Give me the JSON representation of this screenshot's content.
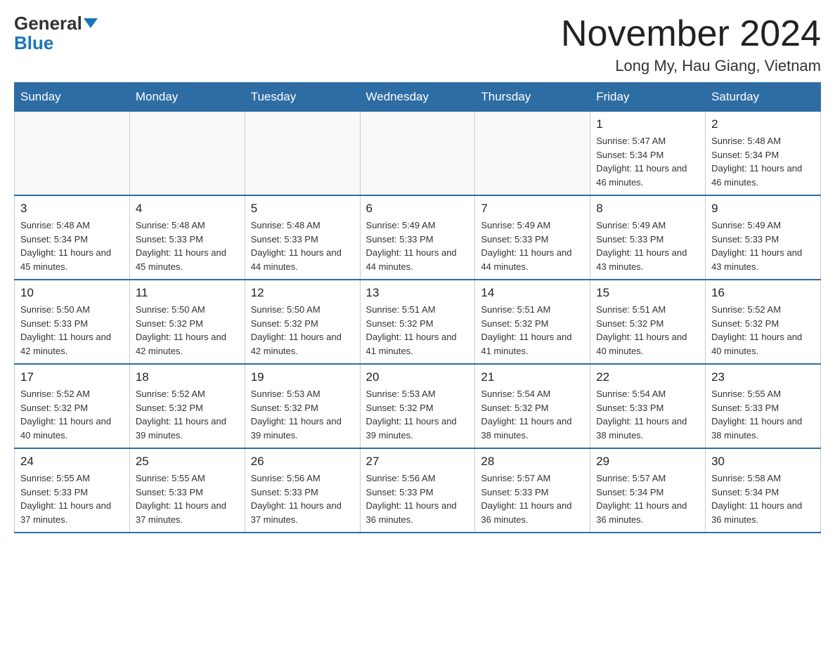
{
  "logo": {
    "general": "General",
    "blue": "Blue"
  },
  "title": "November 2024",
  "subtitle": "Long My, Hau Giang, Vietnam",
  "weekdays": [
    "Sunday",
    "Monday",
    "Tuesday",
    "Wednesday",
    "Thursday",
    "Friday",
    "Saturday"
  ],
  "weeks": [
    [
      {
        "day": "",
        "info": ""
      },
      {
        "day": "",
        "info": ""
      },
      {
        "day": "",
        "info": ""
      },
      {
        "day": "",
        "info": ""
      },
      {
        "day": "",
        "info": ""
      },
      {
        "day": "1",
        "info": "Sunrise: 5:47 AM\nSunset: 5:34 PM\nDaylight: 11 hours and 46 minutes."
      },
      {
        "day": "2",
        "info": "Sunrise: 5:48 AM\nSunset: 5:34 PM\nDaylight: 11 hours and 46 minutes."
      }
    ],
    [
      {
        "day": "3",
        "info": "Sunrise: 5:48 AM\nSunset: 5:34 PM\nDaylight: 11 hours and 45 minutes."
      },
      {
        "day": "4",
        "info": "Sunrise: 5:48 AM\nSunset: 5:33 PM\nDaylight: 11 hours and 45 minutes."
      },
      {
        "day": "5",
        "info": "Sunrise: 5:48 AM\nSunset: 5:33 PM\nDaylight: 11 hours and 44 minutes."
      },
      {
        "day": "6",
        "info": "Sunrise: 5:49 AM\nSunset: 5:33 PM\nDaylight: 11 hours and 44 minutes."
      },
      {
        "day": "7",
        "info": "Sunrise: 5:49 AM\nSunset: 5:33 PM\nDaylight: 11 hours and 44 minutes."
      },
      {
        "day": "8",
        "info": "Sunrise: 5:49 AM\nSunset: 5:33 PM\nDaylight: 11 hours and 43 minutes."
      },
      {
        "day": "9",
        "info": "Sunrise: 5:49 AM\nSunset: 5:33 PM\nDaylight: 11 hours and 43 minutes."
      }
    ],
    [
      {
        "day": "10",
        "info": "Sunrise: 5:50 AM\nSunset: 5:33 PM\nDaylight: 11 hours and 42 minutes."
      },
      {
        "day": "11",
        "info": "Sunrise: 5:50 AM\nSunset: 5:32 PM\nDaylight: 11 hours and 42 minutes."
      },
      {
        "day": "12",
        "info": "Sunrise: 5:50 AM\nSunset: 5:32 PM\nDaylight: 11 hours and 42 minutes."
      },
      {
        "day": "13",
        "info": "Sunrise: 5:51 AM\nSunset: 5:32 PM\nDaylight: 11 hours and 41 minutes."
      },
      {
        "day": "14",
        "info": "Sunrise: 5:51 AM\nSunset: 5:32 PM\nDaylight: 11 hours and 41 minutes."
      },
      {
        "day": "15",
        "info": "Sunrise: 5:51 AM\nSunset: 5:32 PM\nDaylight: 11 hours and 40 minutes."
      },
      {
        "day": "16",
        "info": "Sunrise: 5:52 AM\nSunset: 5:32 PM\nDaylight: 11 hours and 40 minutes."
      }
    ],
    [
      {
        "day": "17",
        "info": "Sunrise: 5:52 AM\nSunset: 5:32 PM\nDaylight: 11 hours and 40 minutes."
      },
      {
        "day": "18",
        "info": "Sunrise: 5:52 AM\nSunset: 5:32 PM\nDaylight: 11 hours and 39 minutes."
      },
      {
        "day": "19",
        "info": "Sunrise: 5:53 AM\nSunset: 5:32 PM\nDaylight: 11 hours and 39 minutes."
      },
      {
        "day": "20",
        "info": "Sunrise: 5:53 AM\nSunset: 5:32 PM\nDaylight: 11 hours and 39 minutes."
      },
      {
        "day": "21",
        "info": "Sunrise: 5:54 AM\nSunset: 5:32 PM\nDaylight: 11 hours and 38 minutes."
      },
      {
        "day": "22",
        "info": "Sunrise: 5:54 AM\nSunset: 5:33 PM\nDaylight: 11 hours and 38 minutes."
      },
      {
        "day": "23",
        "info": "Sunrise: 5:55 AM\nSunset: 5:33 PM\nDaylight: 11 hours and 38 minutes."
      }
    ],
    [
      {
        "day": "24",
        "info": "Sunrise: 5:55 AM\nSunset: 5:33 PM\nDaylight: 11 hours and 37 minutes."
      },
      {
        "day": "25",
        "info": "Sunrise: 5:55 AM\nSunset: 5:33 PM\nDaylight: 11 hours and 37 minutes."
      },
      {
        "day": "26",
        "info": "Sunrise: 5:56 AM\nSunset: 5:33 PM\nDaylight: 11 hours and 37 minutes."
      },
      {
        "day": "27",
        "info": "Sunrise: 5:56 AM\nSunset: 5:33 PM\nDaylight: 11 hours and 36 minutes."
      },
      {
        "day": "28",
        "info": "Sunrise: 5:57 AM\nSunset: 5:33 PM\nDaylight: 11 hours and 36 minutes."
      },
      {
        "day": "29",
        "info": "Sunrise: 5:57 AM\nSunset: 5:34 PM\nDaylight: 11 hours and 36 minutes."
      },
      {
        "day": "30",
        "info": "Sunrise: 5:58 AM\nSunset: 5:34 PM\nDaylight: 11 hours and 36 minutes."
      }
    ]
  ]
}
